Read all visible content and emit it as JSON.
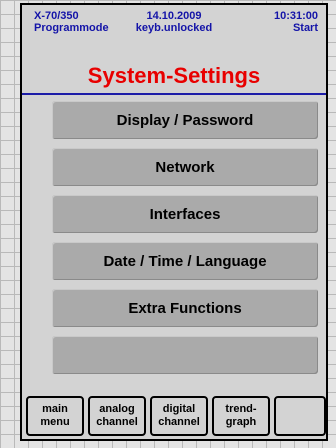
{
  "status": {
    "device": "X-70/350",
    "mode": "Programmode",
    "date": "14.10.2009",
    "keyboard": "keyb.unlocked",
    "time": "10:31:00",
    "state": "Start"
  },
  "title": "System-Settings",
  "menu": [
    {
      "label": "Display / Password"
    },
    {
      "label": "Network"
    },
    {
      "label": "Interfaces"
    },
    {
      "label": "Date / Time / Language"
    },
    {
      "label": "Extra Functions"
    },
    {
      "label": ""
    }
  ],
  "softkeys": [
    {
      "line1": "main",
      "line2": "menu"
    },
    {
      "line1": "analog",
      "line2": "channel"
    },
    {
      "line1": "digital",
      "line2": "channel"
    },
    {
      "line1": "trend-",
      "line2": "graph"
    },
    {
      "line1": "",
      "line2": ""
    }
  ],
  "colors": {
    "status_text": "#1414a8",
    "title": "#e80000",
    "button": "#aaaaaa",
    "panel": "#d3d3d3"
  }
}
